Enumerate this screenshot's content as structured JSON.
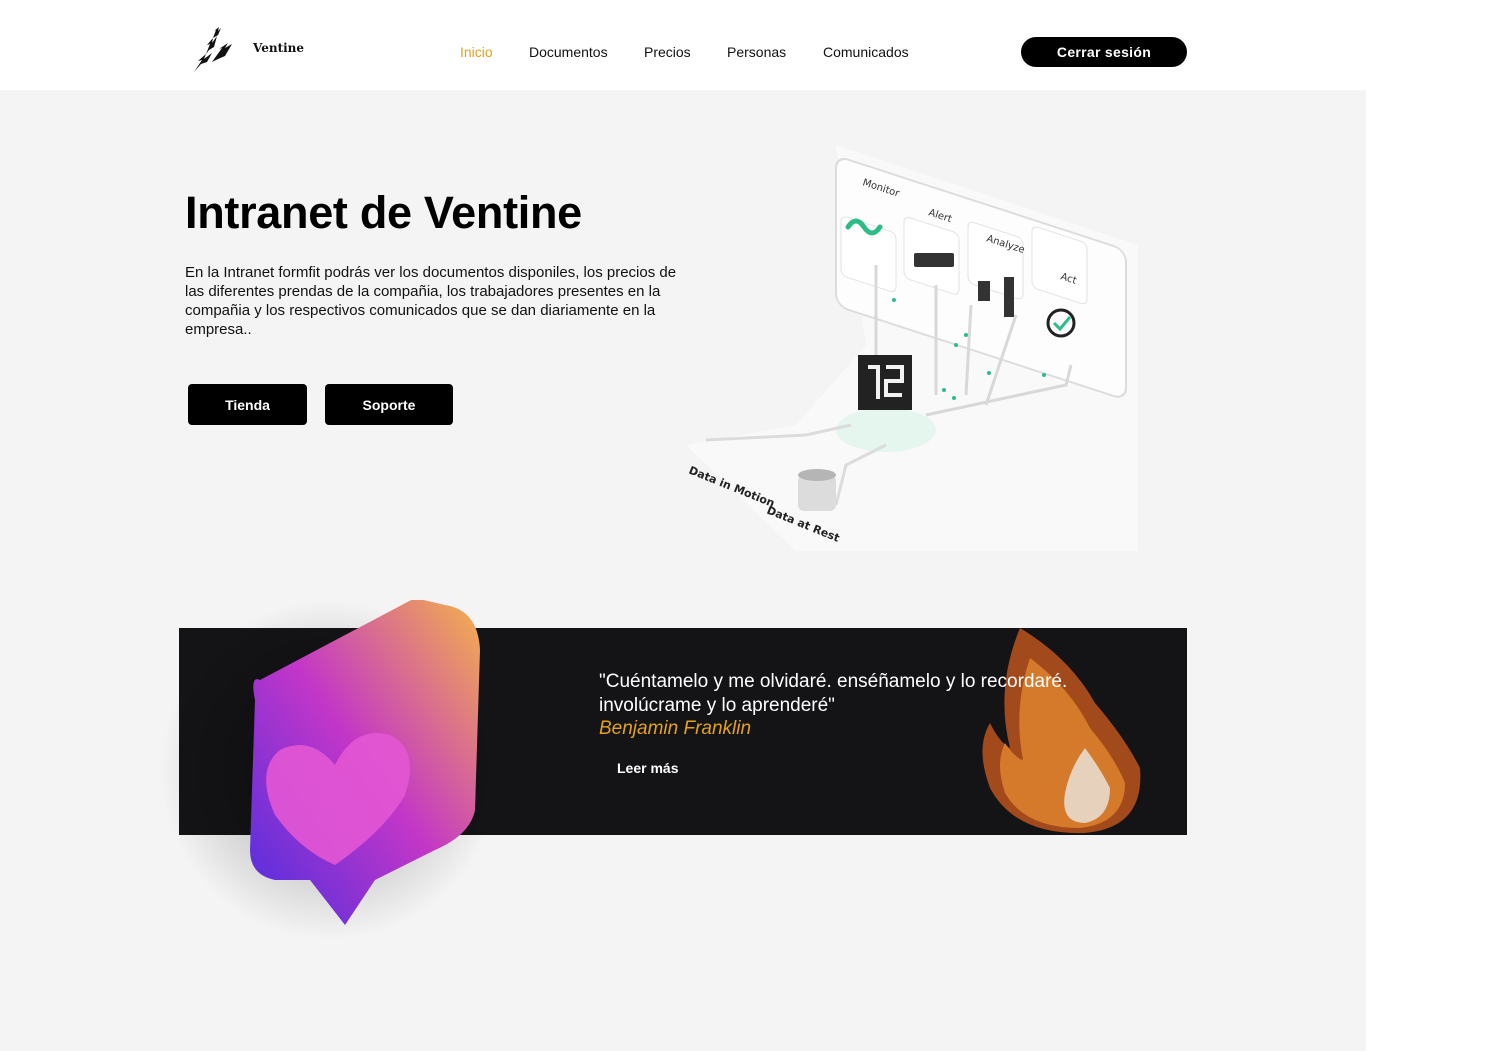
{
  "brand": {
    "name": "Ventine",
    "logo_icon": "birds-logo-icon"
  },
  "nav": {
    "items": [
      {
        "label": "Inicio",
        "active": true
      },
      {
        "label": "Documentos",
        "active": false
      },
      {
        "label": "Precios",
        "active": false
      },
      {
        "label": "Personas",
        "active": false
      },
      {
        "label": "Comunicados",
        "active": false
      }
    ],
    "logout_label": "Cerrar sesión"
  },
  "hero": {
    "title": "Intranet de Ventine",
    "description": "En la Intranet formfit podrás ver los documentos disponiles, los precios de las diferentes prendas de la compañia, los trabajadores presentes en la compañia y los respectivos comunicados que se dan diariamente en la empresa..",
    "buttons": {
      "store": "Tienda",
      "support": "Soporte"
    },
    "illustration": {
      "labels": [
        "Monitor",
        "Alert",
        "Analyze",
        "Act",
        "Data in Motion",
        "Data at Rest"
      ]
    }
  },
  "quote": {
    "text": "\"Cuéntamelo y me olvidaré. enséñamelo y lo recordaré. involúcrame y lo aprenderé\"",
    "author": "Benjamin Franklin",
    "read_more": "Leer más"
  },
  "colors": {
    "accent": "#e3a21a",
    "banner": "#141316",
    "background": "#f4f4f4",
    "button": "#000000"
  }
}
